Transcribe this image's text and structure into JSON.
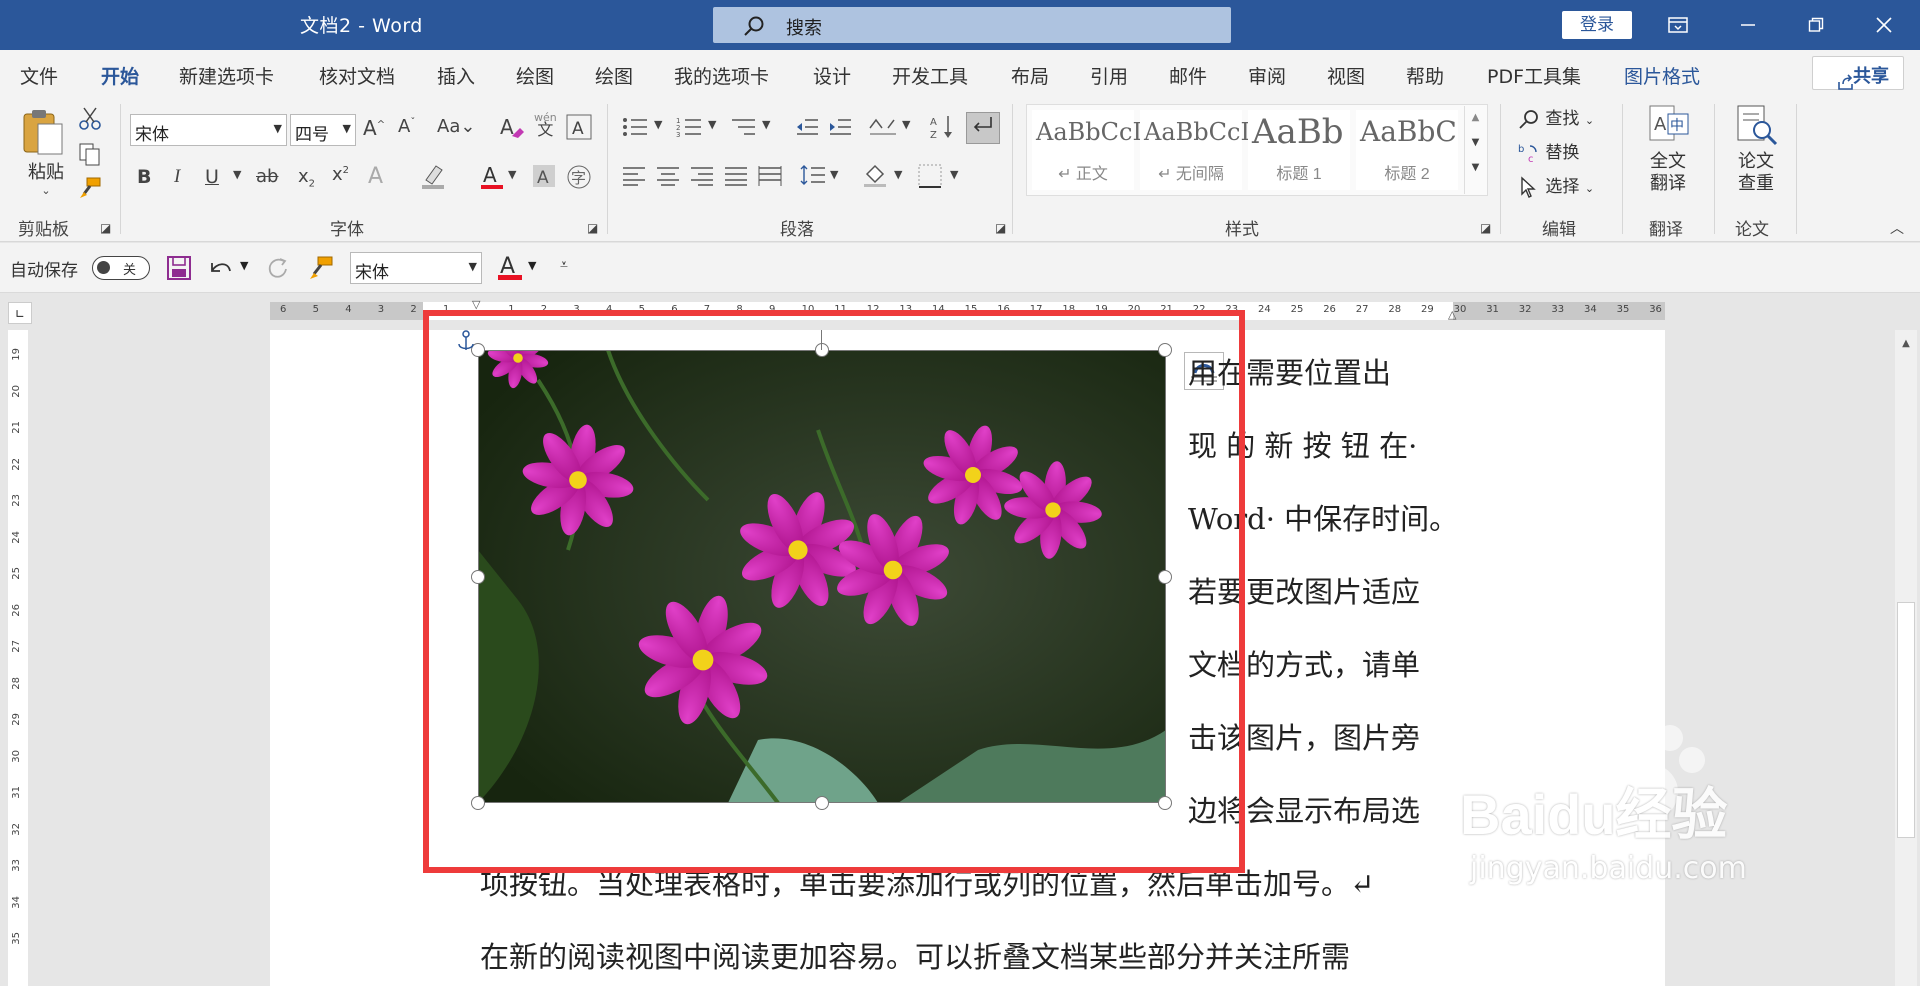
{
  "titlebar": {
    "doc_title": "文档2 - Word",
    "search_placeholder": "搜索",
    "login": "登录",
    "bg_color": "#2b579a"
  },
  "menu": {
    "tabs": [
      "文件",
      "开始",
      "新建选项卡",
      "核对文档",
      "插入",
      "绘图",
      "绘图",
      "我的选项卡",
      "设计",
      "开发工具",
      "布局",
      "引用",
      "邮件",
      "审阅",
      "视图",
      "帮助",
      "PDF工具集",
      "图片格式"
    ],
    "active": "开始",
    "share": "共享"
  },
  "ribbon": {
    "clipboard": {
      "paste": "粘贴",
      "label": "剪贴板"
    },
    "font": {
      "name": "宋体",
      "size": "四号",
      "label": "字体",
      "pinyin": "wén"
    },
    "paragraph": {
      "label": "段落"
    },
    "styles": {
      "label": "样式",
      "items": [
        {
          "sample": "AaBbCcI",
          "name": "↵ 正文"
        },
        {
          "sample": "AaBbCcI",
          "name": "↵ 无间隔"
        },
        {
          "sample": "AaBb",
          "name": "标题 1"
        },
        {
          "sample": "AaBbC",
          "name": "标题 2"
        }
      ]
    },
    "editing": {
      "find": "查找",
      "replace": "替换",
      "select": "选择",
      "label": "编辑"
    },
    "translate": {
      "button": "全文\n翻译",
      "label": "翻译"
    },
    "paper": {
      "button": "论文\n查重",
      "label": "论文"
    }
  },
  "qat": {
    "autosave": "自动保存",
    "toggle": "关",
    "font": "宋体"
  },
  "document": {
    "side_lines": [
      "用在需要位置出",
      "现 的 新 按 钮 在·",
      "Word· 中保存时间。",
      "若要更改图片适应",
      "文档的方式，请单",
      "击该图片，图片旁",
      "边将会显示布局选"
    ],
    "line_8": "项按钮。当处理表格时，单击要添加行或列的位置，然后单击加号。↵",
    "line_9": "在新的阅读视图中阅读更加容易。可以折叠文档某些部分并关注所需"
  },
  "ruler": {
    "h_ticks": [
      "6",
      "5",
      "4",
      "3",
      "2",
      "1",
      "",
      "1",
      "2",
      "3",
      "4",
      "5",
      "6",
      "7",
      "8",
      "9",
      "10",
      "11",
      "12",
      "13",
      "14",
      "15",
      "16",
      "17",
      "18",
      "19",
      "20",
      "21",
      "22",
      "23",
      "24",
      "25",
      "26",
      "27",
      "28",
      "29",
      "30",
      "31",
      "32",
      "33",
      "34",
      "35",
      "36"
    ],
    "v_ticks": [
      "19",
      "20",
      "21",
      "22",
      "23",
      "24",
      "25",
      "26",
      "27",
      "28",
      "29",
      "30",
      "31",
      "32",
      "33",
      "34",
      "35"
    ]
  },
  "watermark": {
    "brand": "Baidu经验",
    "url": "jingyan.baidu.com"
  },
  "colors": {
    "accent": "#2b579a",
    "highlight_box": "#ee3b3b",
    "font_red": "#e81123"
  }
}
